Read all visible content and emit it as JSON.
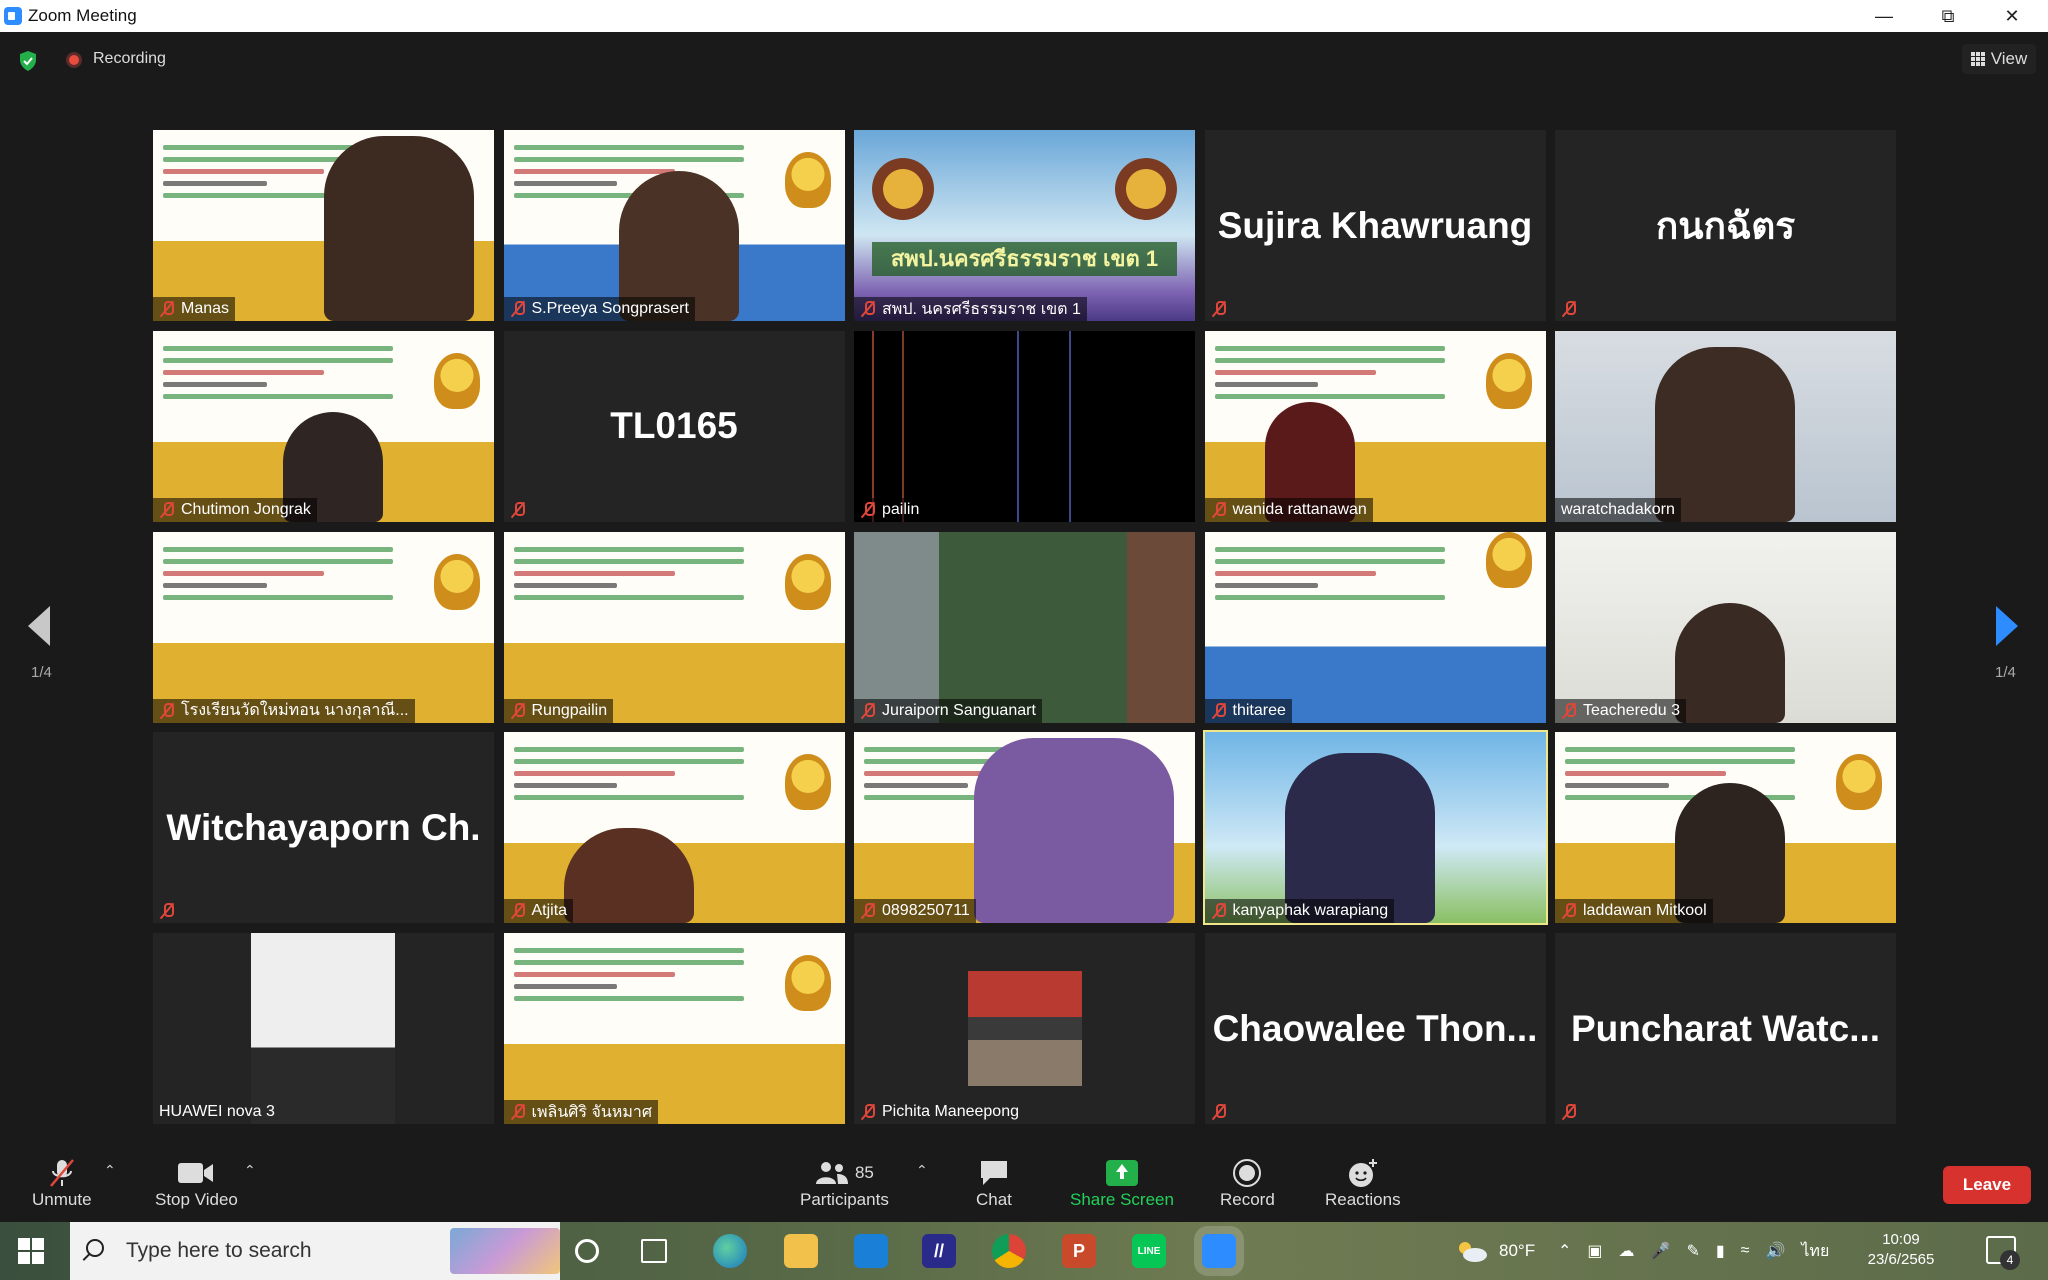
{
  "window": {
    "title": "Zoom Meeting"
  },
  "topbar": {
    "recording_label": "Recording",
    "view_label": "View"
  },
  "pagination": {
    "left": "1/4",
    "right": "1/4"
  },
  "tiles": [
    {
      "label": "Manas",
      "bigname": ""
    },
    {
      "label": "S.Preeya Songprasert",
      "bigname": ""
    },
    {
      "label": "สพป. นครศรีธรรมราช เขต 1",
      "bigname": ""
    },
    {
      "label": "",
      "bigname": "Sujira  Khawruang"
    },
    {
      "label": "",
      "bigname": "กนกฉัตร"
    },
    {
      "label": "Chutimon Jongrak",
      "bigname": ""
    },
    {
      "label": "",
      "bigname": "TL0165"
    },
    {
      "label": "pailin",
      "bigname": ""
    },
    {
      "label": "wanida rattanawan",
      "bigname": ""
    },
    {
      "label": "waratchadakorn",
      "bigname": ""
    },
    {
      "label": "โรงเรียนวัดใหม่ทอน นางกุลาณี...",
      "bigname": ""
    },
    {
      "label": "Rungpailin",
      "bigname": ""
    },
    {
      "label": "Juraiporn Sanguanart",
      "bigname": ""
    },
    {
      "label": "thitaree",
      "bigname": ""
    },
    {
      "label": "Teacheredu 3",
      "bigname": ""
    },
    {
      "label": "",
      "bigname": "Witchayaporn Ch."
    },
    {
      "label": "Atjita",
      "bigname": ""
    },
    {
      "label": "0898250711",
      "bigname": ""
    },
    {
      "label": "kanyaphak warapiang",
      "bigname": ""
    },
    {
      "label": "laddawan  Mitkool",
      "bigname": ""
    },
    {
      "label": "HUAWEI nova 3",
      "bigname": ""
    },
    {
      "label": "เพลินศิริ จันหมาศ",
      "bigname": ""
    },
    {
      "label": "Pichita  Maneepong",
      "bigname": ""
    },
    {
      "label": "",
      "bigname": "Chaowalee  Thon..."
    },
    {
      "label": "",
      "bigname": "Puncharat  Watc..."
    }
  ],
  "temple_banner": "สพป.นครศรีธรรมราช เขต 1",
  "toolbar": {
    "unmute": "Unmute",
    "stop_video": "Stop Video",
    "participants_count": "85",
    "participants": "Participants",
    "chat": "Chat",
    "share_screen": "Share Screen",
    "record": "Record",
    "reactions": "Reactions",
    "leave": "Leave"
  },
  "taskbar": {
    "search_placeholder": "Type here to search",
    "weather": "80°F",
    "language": "ไทย",
    "time": "10:09",
    "date": "23/6/2565",
    "notifications": "4"
  },
  "colors": {
    "accent_blue": "#2d8cff",
    "leave_red": "#d7322e",
    "share_green": "#23b04a",
    "mute_red": "#e0463a",
    "active_speaker": "#f0e68c"
  }
}
